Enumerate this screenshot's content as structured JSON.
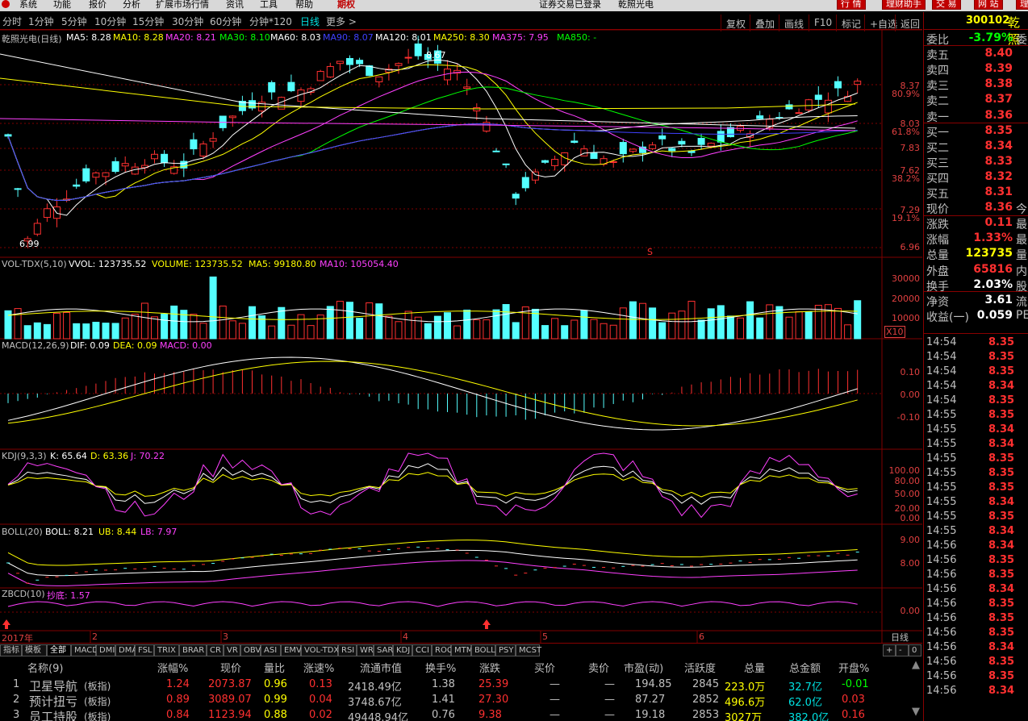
{
  "menubar": {
    "items": [
      "系统",
      "功能",
      "报价",
      "分析",
      "扩展市场行情",
      "资讯",
      "工具",
      "帮助"
    ],
    "highlight": "期权",
    "status": "证券交易已登录",
    "stock_title": "乾照光电",
    "quick_buttons": [
      "行 情",
      "理财助手",
      "交 易",
      "网 站",
      "理"
    ]
  },
  "periods": {
    "items": [
      "分时",
      "1分钟",
      "5分钟",
      "10分钟",
      "15分钟",
      "30分钟",
      "60分钟",
      "分钟*120",
      "日线",
      "更多 >"
    ],
    "selected": "日线"
  },
  "toolbar": {
    "buttons": [
      "复权",
      "叠加",
      "画线",
      "F10",
      "标记",
      "+自选",
      "返回"
    ]
  },
  "main": {
    "name": "乾照光电(日线)",
    "mas": [
      {
        "label": "MA5: 8.28",
        "color": "#ffffff"
      },
      {
        "label": "MA10: 8.28",
        "color": "#ffff00"
      },
      {
        "label": "MA20: 8.21",
        "color": "#ff40ff"
      },
      {
        "label": "MA30: 8.10",
        "color": "#00ff00"
      },
      {
        "label": "MA60: 8.03",
        "color": "#ffffff"
      },
      {
        "label": "MA90: 8.07",
        "color": "#4040ff"
      },
      {
        "label": "MA120: 8.01",
        "color": "#ffffff"
      },
      {
        "label": "MA250: 8.30",
        "color": "#ffff00"
      },
      {
        "label": "MA375: 7.95",
        "color": "#ff40ff"
      },
      {
        "label": "MA850: -",
        "color": "#00ff00"
      }
    ],
    "axis": [
      {
        "v": "8.37",
        "sub": "80.9%"
      },
      {
        "v": "8.03",
        "sub": "61.8%"
      },
      {
        "v": "7.83",
        "sub": ""
      },
      {
        "v": "7.62",
        "sub": "38.2%"
      },
      {
        "v": "7.29",
        "sub": "19.1%"
      },
      {
        "v": "6.96",
        "sub": ""
      }
    ],
    "high_label": "8.67",
    "low_label": "6.99",
    "marker": "S"
  },
  "vol": {
    "title": "VOL-TDX(5,10)",
    "vvol": "VVOL: 123735.52",
    "volume": "VOLUME: 123735.52",
    "ma5": "MA5: 99180.80",
    "ma10": "MA10: 105054.40",
    "axis": [
      "30000",
      "20000",
      "10000"
    ],
    "unit": "X10"
  },
  "macd": {
    "title": "MACD(12,26,9)",
    "dif": "DIF: 0.09",
    "dea": "DEA: 0.09",
    "macd": "MACD: 0.00",
    "axis": [
      "0.10",
      "0.00",
      "-0.10"
    ]
  },
  "kdj": {
    "title": "KDJ(9,3,3)",
    "k": "K: 65.64",
    "d": "D: 63.36",
    "j": "J: 70.22",
    "axis": [
      "100.00",
      "80.00",
      "50.00",
      "20.00",
      "0.00"
    ]
  },
  "boll": {
    "title": "BOLL(20)",
    "boll": "BOLL: 8.21",
    "ub": "UB: 8.44",
    "lb": "LB: 7.97",
    "axis": [
      "9.00",
      "8.00"
    ]
  },
  "zbcd": {
    "title": "ZBCD(10)",
    "val": "抄底: 1.57",
    "axis": [
      "0.00"
    ]
  },
  "dates": {
    "year": "2017年",
    "months": [
      "2",
      "3",
      "4",
      "5",
      "6"
    ],
    "period_btn": "日线"
  },
  "indicator_tabs": [
    "指标",
    "模板",
    "全部",
    "MACD",
    "DMI",
    "DMA",
    "FSL",
    "TRIX",
    "BRAR",
    "CR",
    "VR",
    "OBV",
    "ASI",
    "EMV",
    "VOL-TDX",
    "RSI",
    "WR",
    "SAR",
    "KDJ",
    "CCI",
    "ROC",
    "MTM",
    "BOLL",
    "PSY",
    "MCST"
  ],
  "table": {
    "headers": [
      "名称(9)",
      "涨幅%",
      "现价",
      "量比",
      "涨速%",
      "流通市值",
      "换手%",
      "涨跌",
      "买价",
      "卖价",
      "市盈(动)",
      "活跃度",
      "总量",
      "总金额",
      "开盘%"
    ],
    "rows": [
      {
        "no": "1",
        "name": "卫星导航",
        "tag": "(板指)",
        "chg": "1.24",
        "price": "2073.87",
        "vr": "0.96",
        "speed": "0.13",
        "mcap": "2418.49亿",
        "turn": "1.38",
        "diff": "25.39",
        "bid": "—",
        "ask": "—",
        "pe": "194.85",
        "act": "2845",
        "vol": "223.0万",
        "amt": "32.7亿",
        "open": "-0.01"
      },
      {
        "no": "2",
        "name": "预计扭亏",
        "tag": "(板指)",
        "chg": "0.89",
        "price": "3089.07",
        "vr": "0.99",
        "speed": "0.04",
        "mcap": "3748.67亿",
        "turn": "1.41",
        "diff": "27.30",
        "bid": "—",
        "ask": "—",
        "pe": "87.27",
        "act": "2852",
        "vol": "496.6万",
        "amt": "62.0亿",
        "open": "0.03"
      },
      {
        "no": "3",
        "name": "员工持股",
        "tag": "(板指)",
        "chg": "0.84",
        "price": "1123.94",
        "vr": "0.88",
        "speed": "0.02",
        "mcap": "49448.94亿",
        "turn": "0.76",
        "diff": "9.38",
        "bid": "—",
        "ask": "—",
        "pe": "19.18",
        "act": "2853",
        "vol": "3027万",
        "amt": "382.0亿",
        "open": "0.16"
      }
    ]
  },
  "quote": {
    "code": "300102",
    "name": "乾照",
    "rows": [
      {
        "lab": "委比",
        "val": "-3.79%",
        "ext": "委",
        "color": "#00ff00"
      },
      {
        "lab": "卖五",
        "val": "8.40",
        "color": "#ff3030"
      },
      {
        "lab": "卖四",
        "val": "8.39",
        "color": "#ff3030"
      },
      {
        "lab": "卖三",
        "val": "8.38",
        "color": "#ff3030"
      },
      {
        "lab": "卖二",
        "val": "8.37",
        "color": "#ff3030"
      },
      {
        "lab": "卖一",
        "val": "8.36",
        "color": "#ff3030"
      },
      {
        "lab": "买一",
        "val": "8.35",
        "color": "#ff3030"
      },
      {
        "lab": "买二",
        "val": "8.34",
        "color": "#ff3030"
      },
      {
        "lab": "买三",
        "val": "8.33",
        "color": "#ff3030"
      },
      {
        "lab": "买四",
        "val": "8.32",
        "color": "#ff3030"
      },
      {
        "lab": "买五",
        "val": "8.31",
        "color": "#ff3030"
      },
      {
        "lab": "现价",
        "val": "8.36",
        "ext": "今",
        "color": "#ff3030"
      },
      {
        "lab": "涨跌",
        "val": "0.11",
        "ext": "最",
        "color": "#ff3030"
      },
      {
        "lab": "涨幅",
        "val": "1.33%",
        "ext": "最",
        "color": "#ff3030"
      },
      {
        "lab": "总量",
        "val": "123735",
        "ext": "量",
        "color": "#ffff00"
      },
      {
        "lab": "外盘",
        "val": "65816",
        "ext": "内",
        "color": "#ff3030"
      },
      {
        "lab": "换手",
        "val": "2.03%",
        "ext": "股",
        "color": "#ffffff"
      },
      {
        "lab": "净资",
        "val": "3.61",
        "ext": "流",
        "color": "#ffffff"
      },
      {
        "lab": "收益(一)",
        "val": "0.059",
        "ext": "PE",
        "color": "#ffffff"
      }
    ],
    "ticks": [
      [
        "14:54",
        "8.35"
      ],
      [
        "14:54",
        "8.35"
      ],
      [
        "14:54",
        "8.35"
      ],
      [
        "14:54",
        "8.34"
      ],
      [
        "14:54",
        "8.35"
      ],
      [
        "14:55",
        "8.35"
      ],
      [
        "14:55",
        "8.34"
      ],
      [
        "14:55",
        "8.34"
      ],
      [
        "14:55",
        "8.35"
      ],
      [
        "14:55",
        "8.35"
      ],
      [
        "14:55",
        "8.35"
      ],
      [
        "14:55",
        "8.34"
      ],
      [
        "14:55",
        "8.35"
      ],
      [
        "14:55",
        "8.34"
      ],
      [
        "14:56",
        "8.34"
      ],
      [
        "14:56",
        "8.35"
      ],
      [
        "14:56",
        "8.35"
      ],
      [
        "14:56",
        "8.34"
      ],
      [
        "14:56",
        "8.35"
      ],
      [
        "14:56",
        "8.35"
      ],
      [
        "14:56",
        "8.35"
      ],
      [
        "14:56",
        "8.34"
      ],
      [
        "14:56",
        "8.35"
      ],
      [
        "14:56",
        "8.35"
      ],
      [
        "14:56",
        "8.34"
      ]
    ]
  },
  "colors": {
    "up": "#ff3030",
    "down": "#54ffff",
    "grid": "#800000"
  }
}
